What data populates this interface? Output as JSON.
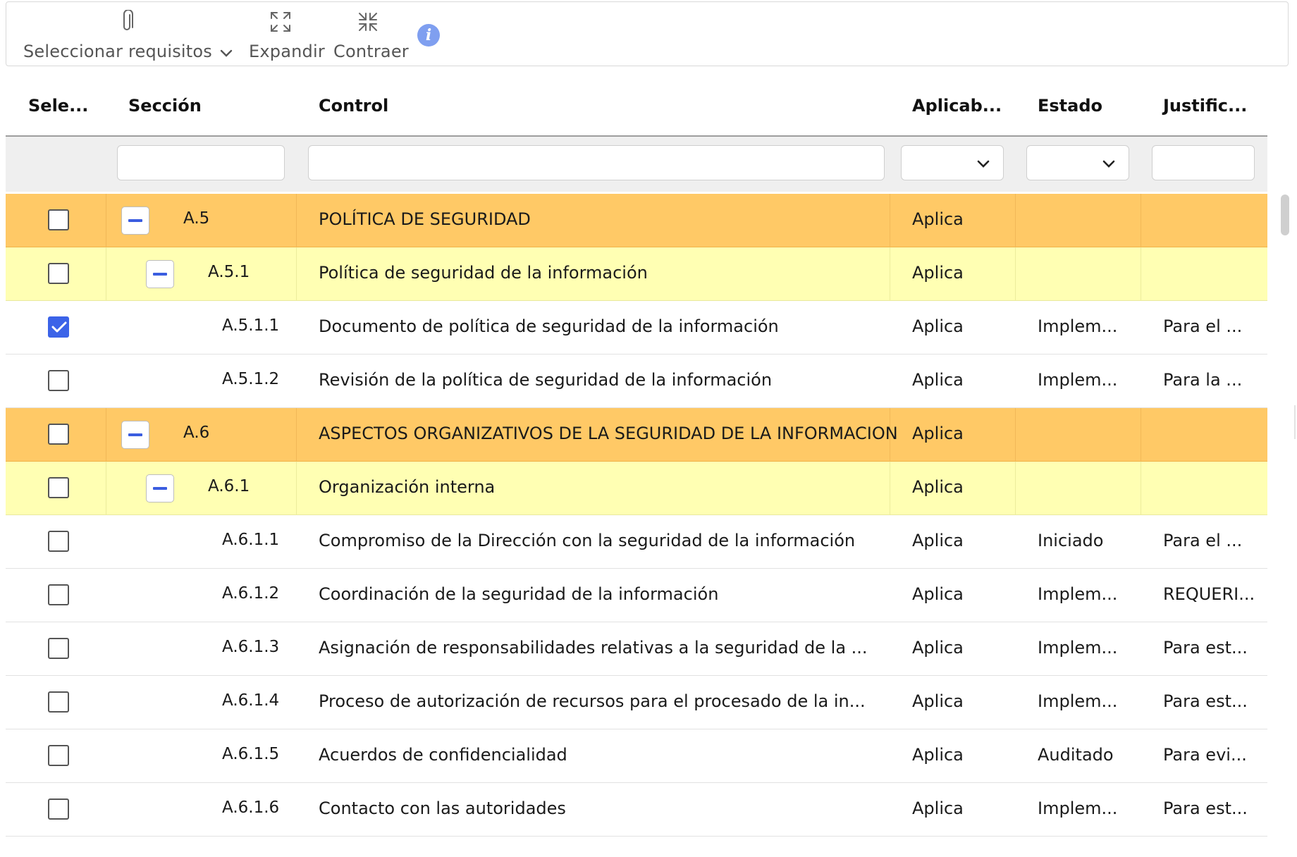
{
  "toolbar": {
    "select_label": "Seleccionar requisitos",
    "expand_label": "Expandir",
    "collapse_label": "Contraer",
    "info_glyph": "i",
    "icons": {
      "select": "paperclip-icon",
      "expand": "expand-arrows-icon",
      "collapse": "collapse-arrows-icon",
      "info": "info-icon"
    }
  },
  "columns": {
    "select": "Sele...",
    "section": "Sección",
    "control": "Control",
    "applicability": "Aplicab...",
    "status": "Estado",
    "justification": "Justific..."
  },
  "filters": {
    "section": "",
    "control": "",
    "applicability": "",
    "status": "",
    "justification": ""
  },
  "rows": [
    {
      "level": 0,
      "checked": false,
      "section": "A.5",
      "control": "POLÍTICA DE SEGURIDAD",
      "applicability": "Aplica",
      "status": "",
      "justification": ""
    },
    {
      "level": 1,
      "checked": false,
      "section": "A.5.1",
      "control": "Política de seguridad de la información",
      "applicability": "Aplica",
      "status": "",
      "justification": ""
    },
    {
      "level": 2,
      "checked": true,
      "section": "A.5.1.1",
      "control": "Documento de política de seguridad de la información",
      "applicability": "Aplica",
      "status": "Implem...",
      "justification": "Para el ..."
    },
    {
      "level": 2,
      "checked": false,
      "section": "A.5.1.2",
      "control": "Revisión de la política de seguridad de la información",
      "applicability": "Aplica",
      "status": "Implem...",
      "justification": "Para la ..."
    },
    {
      "level": 0,
      "checked": false,
      "section": "A.6",
      "control": "ASPECTOS ORGANIZATIVOS DE LA SEGURIDAD DE LA INFORMACION",
      "applicability": "Aplica",
      "status": "",
      "justification": ""
    },
    {
      "level": 1,
      "checked": false,
      "section": "A.6.1",
      "control": "Organización interna",
      "applicability": "Aplica",
      "status": "",
      "justification": ""
    },
    {
      "level": 2,
      "checked": false,
      "section": "A.6.1.1",
      "control": "Compromiso de la Dirección con la seguridad de la información",
      "applicability": "Aplica",
      "status": "Iniciado",
      "justification": "Para el ..."
    },
    {
      "level": 2,
      "checked": false,
      "section": "A.6.1.2",
      "control": "Coordinación de la seguridad de la información",
      "applicability": "Aplica",
      "status": "Implem...",
      "justification": "REQUERI..."
    },
    {
      "level": 2,
      "checked": false,
      "section": "A.6.1.3",
      "control": "Asignación de responsabilidades relativas a la seguridad de la ...",
      "applicability": "Aplica",
      "status": "Implem...",
      "justification": "Para est..."
    },
    {
      "level": 2,
      "checked": false,
      "section": "A.6.1.4",
      "control": "Proceso de autorización de recursos para el procesado de la in...",
      "applicability": "Aplica",
      "status": "Implem...",
      "justification": "Para est..."
    },
    {
      "level": 2,
      "checked": false,
      "section": "A.6.1.5",
      "control": "Acuerdos de confidencialidad",
      "applicability": "Aplica",
      "status": "Auditado",
      "justification": "Para evi..."
    },
    {
      "level": 2,
      "checked": false,
      "section": "A.6.1.6",
      "control": "Contacto con las autoridades",
      "applicability": "Aplica",
      "status": "Implem...",
      "justification": "Para est..."
    }
  ],
  "colors": {
    "level0_bg": "#ffc966",
    "level1_bg": "#ffffb3",
    "accent": "#3b63e8",
    "info": "#7f9ff0"
  }
}
